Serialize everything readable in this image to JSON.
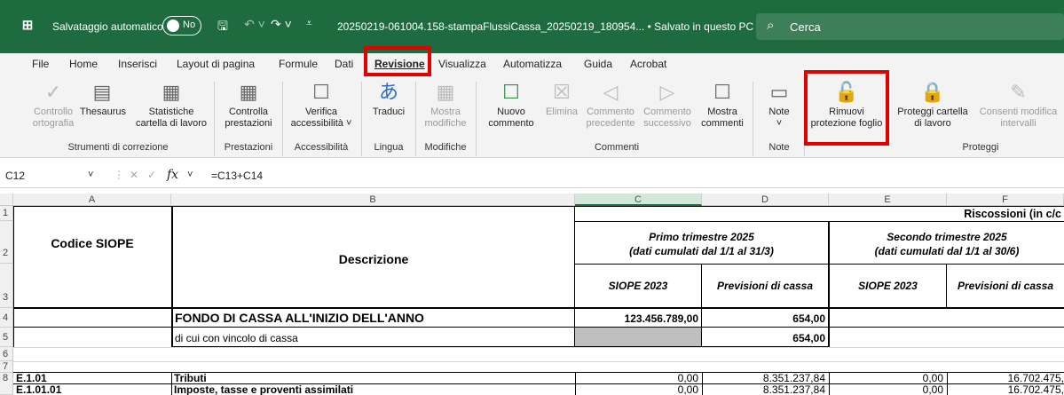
{
  "titlebar": {
    "autosave_label": "Salvataggio automatico",
    "toggle_state": "No",
    "document_title": "20250219-061004.158-stampaFlussiCassa_20250219_180954...  •  Salvato in questo PC ∨",
    "search_placeholder": "Cerca"
  },
  "menu": [
    "File",
    "Home",
    "Inserisci",
    "Layout di pagina",
    "Formule",
    "Dati",
    "Revisione",
    "Visualizza",
    "Automatizza",
    "Guida",
    "Acrobat"
  ],
  "ribbon": {
    "buttons": {
      "controllo": "Controllo ortografia",
      "thesaurus": "Thesaurus",
      "statistiche": "Statistiche cartella di lavoro",
      "controlla_prest": "Controlla prestazioni",
      "verifica": "Verifica accessibilità ˅",
      "traduci": "Traduci",
      "mostra_modifiche": "Mostra modifiche",
      "nuovo_commento": "Nuovo commento",
      "elimina": "Elimina",
      "commento_prec": "Commento precedente",
      "commento_succ": "Commento successivo",
      "mostra_commenti": "Mostra commenti",
      "note": "Note",
      "rimuovi": "Rimuovi protezione foglio",
      "proteggi": "Proteggi cartella di lavoro",
      "consenti": "Consenti modifica intervalli"
    },
    "groups": [
      "Strumenti di correzione",
      "Prestazioni",
      "Accessibilità",
      "Lingua",
      "Modifiche",
      "Commenti",
      "Note",
      "Proteggi"
    ]
  },
  "formula_bar": {
    "cell": "C12",
    "formula": "=C13+C14"
  },
  "columns": [
    "A",
    "B",
    "C",
    "D",
    "E",
    "F"
  ],
  "rows": [
    "1",
    "2",
    "3",
    "4",
    "5",
    "6",
    "7",
    "8"
  ],
  "sheet": {
    "riscossioni": "Riscossioni  (in c/c",
    "codice": "Codice SIOPE",
    "descrizione": "Descrizione",
    "primo_tr": "Primo trimestre 2025",
    "primo_dati": "(dati cumulati dal 1/1 al 31/3)",
    "secondo_tr": "Secondo trimestre 2025",
    "secondo_dati": "(dati cumulati dal 1/1 al 30/6)",
    "siope_c": "SIOPE 2023",
    "prev_d": "Previsioni di cassa",
    "siope_e": "SIOPE 2023",
    "prev_f": "Previsioni di cassa",
    "r4_b": "FONDO DI CASSA ALL'INIZIO DELL'ANNO",
    "r4_c": "123.456.789,00",
    "r4_d": "654,00",
    "r5_b": "di cui  con vincolo di cassa",
    "r5_d": "654,00",
    "r7_a": "E.1.01",
    "r7_b": "Tributi",
    "r7_c": "0,00",
    "r7_d": "8.351.237,84",
    "r7_e": "0,00",
    "r7_f": "16.702.475,",
    "r8_a": "E.1.01.01",
    "r8_b": "Imposte, tasse e proventi assimilati",
    "r8_c": "0,00",
    "r8_d": "8.351.237,84",
    "r8_e": "0,00",
    "r8_f": "16.702.475,"
  },
  "colors": {
    "excel_green": "#1e6b40",
    "highlight_red": "#e00000",
    "gray_fill": "#bfbfbf"
  }
}
